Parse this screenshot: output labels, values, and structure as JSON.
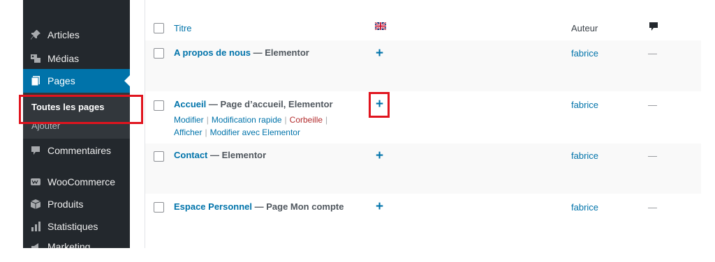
{
  "sidebar": {
    "items": [
      {
        "label": "Articles",
        "icon": "pin-icon"
      },
      {
        "label": "Médias",
        "icon": "media-icon"
      },
      {
        "label": "Pages",
        "icon": "pages-icon"
      },
      {
        "label": "Commentaires",
        "icon": "comment-icon"
      },
      {
        "label": "WooCommerce",
        "icon": "woo-icon"
      },
      {
        "label": "Produits",
        "icon": "products-icon"
      },
      {
        "label": "Statistiques",
        "icon": "stats-icon"
      },
      {
        "label": "Marketing",
        "icon": "marketing-icon"
      }
    ],
    "submenu": {
      "all_pages": "Toutes les pages",
      "add": "Ajouter"
    }
  },
  "table": {
    "headers": {
      "title": "Titre",
      "language_flag": "uk-flag-icon",
      "author": "Auteur",
      "comments_icon": "comment-bubble-icon"
    },
    "rows": [
      {
        "title": "A propos de nous",
        "state": " — Elementor",
        "author": "fabrice",
        "comments": "—"
      },
      {
        "title": "Accueil",
        "state": " — Page d’accueil, Elementor",
        "author": "fabrice",
        "comments": "—",
        "actions": {
          "edit": "Modifier",
          "quick_edit": "Modification rapide",
          "trash": "Corbeille",
          "view": "Afficher",
          "edit_elementor": "Modifier avec Elementor"
        }
      },
      {
        "title": "Contact",
        "state": " — Elementor",
        "author": "fabrice",
        "comments": "—"
      },
      {
        "title": "Espace Personnel",
        "state": " — Page Mon compte",
        "author": "fabrice",
        "comments": "—"
      }
    ],
    "add_translation_symbol": "+"
  },
  "colors": {
    "sidebar_bg": "#23282d",
    "active": "#0073aa",
    "link": "#0073aa",
    "highlight": "#e0141e",
    "trash": "#b32d2e"
  }
}
